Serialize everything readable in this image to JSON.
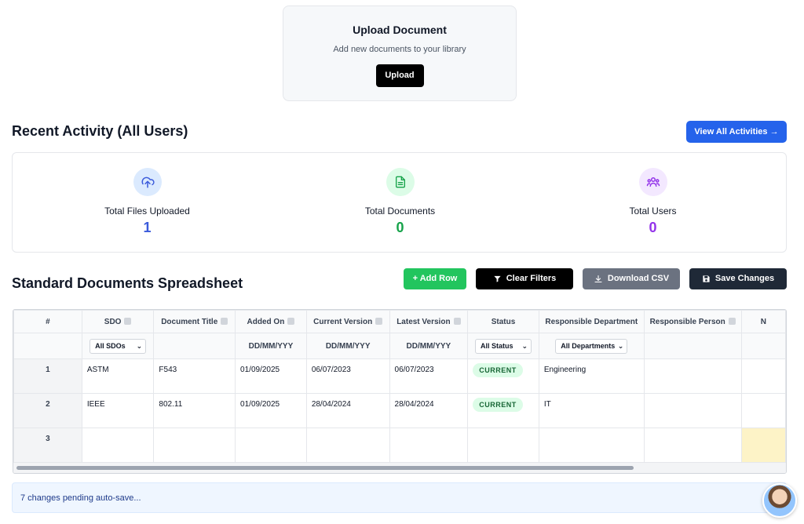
{
  "upload": {
    "title": "Upload Document",
    "subtitle": "Add new documents to your library",
    "button": "Upload"
  },
  "activity": {
    "title": "Recent Activity (All Users)",
    "view_all": "View All Activities →",
    "stats": [
      {
        "label": "Total Files Uploaded",
        "value": "1",
        "color": "#3b5bdb",
        "icon": "cloud-upload-icon"
      },
      {
        "label": "Total Documents",
        "value": "0",
        "color": "#16a34a",
        "icon": "document-icon"
      },
      {
        "label": "Total Users",
        "value": "0",
        "color": "#9333ea",
        "icon": "users-icon"
      }
    ]
  },
  "spreadsheet": {
    "title": "Standard Documents Spreadsheet",
    "buttons": {
      "add_row": "+ Add Row",
      "clear_filters": "Clear Filters",
      "download_csv": "Download CSV",
      "save_changes": "Save Changes"
    },
    "columns": [
      "#",
      "SDO",
      "Document Title",
      "Added On",
      "Current Version",
      "Latest Version",
      "Status",
      "Responsible Department",
      "Responsible Person",
      "N"
    ],
    "filters": {
      "sdo": "All SDOs",
      "date_format": "DD/MM/YYY",
      "status": "All Status",
      "department": "All Departments"
    },
    "rows": [
      {
        "num": "1",
        "sdo": "ASTM",
        "title": "F543",
        "added": "01/09/2025",
        "current": "06/07/2023",
        "latest": "06/07/2023",
        "status": "CURRENT",
        "department": "Engineering",
        "person": ""
      },
      {
        "num": "2",
        "sdo": "IEEE",
        "title": "802.11",
        "added": "01/09/2025",
        "current": "28/04/2024",
        "latest": "28/04/2024",
        "status": "CURRENT",
        "department": "IT",
        "person": ""
      },
      {
        "num": "3",
        "sdo": "",
        "title": "",
        "added": "",
        "current": "",
        "latest": "",
        "status": "",
        "department": "",
        "person": ""
      }
    ]
  },
  "status_bar": {
    "text": "7 changes pending auto-save..."
  }
}
